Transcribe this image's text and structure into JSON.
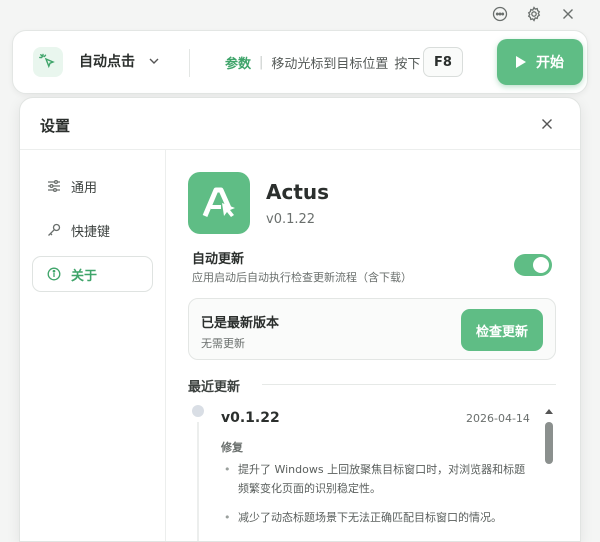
{
  "window": {
    "icons": [
      "chat-icon",
      "gear-icon",
      "close-icon"
    ]
  },
  "toolbar": {
    "mode_label": "自动点击",
    "params_label": "参数",
    "params_separator": "|",
    "params_text": "移动光标到目标位置",
    "hotkey_prefix": "按下",
    "hotkey": "F8",
    "start_label": "开始"
  },
  "dialog": {
    "title": "设置",
    "nav": [
      {
        "label": "通用",
        "icon": "sliders-icon"
      },
      {
        "label": "快捷键",
        "icon": "key-icon"
      },
      {
        "label": "关于",
        "icon": "info-icon",
        "active": true
      }
    ],
    "about": {
      "app_name": "Actus",
      "version": "v0.1.22",
      "auto_update_title": "自动更新",
      "auto_update_desc": "应用启动后自动执行检查更新流程（含下载）",
      "auto_update_enabled": true,
      "status_title": "已是最新版本",
      "status_desc": "无需更新",
      "check_button": "检查更新",
      "recent_title": "最近更新",
      "entries": [
        {
          "version": "v0.1.22",
          "date": "2026-04-14",
          "section": "修复",
          "items": [
            "提升了 Windows 上回放聚焦目标窗口时，对浏览器和标题频繁变化页面的识别稳定性。",
            "减少了动态标题场景下无法正确匹配目标窗口的情况。"
          ]
        }
      ]
    }
  },
  "colors": {
    "accent": "#5fbd85",
    "accent_text": "#3fa46a"
  }
}
